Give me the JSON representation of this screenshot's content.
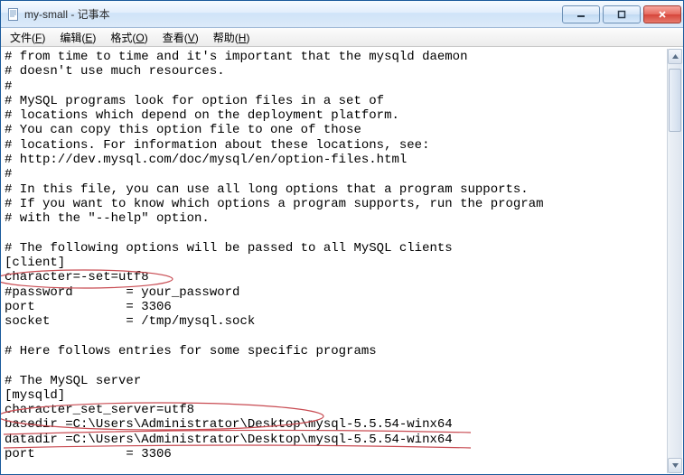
{
  "window": {
    "title": "my-small - 记事本"
  },
  "menu": {
    "file": {
      "label": "文件",
      "accel": "F"
    },
    "edit": {
      "label": "编辑",
      "accel": "E"
    },
    "format": {
      "label": "格式",
      "accel": "O"
    },
    "view": {
      "label": "查看",
      "accel": "V"
    },
    "help": {
      "label": "帮助",
      "accel": "H"
    }
  },
  "content": {
    "lines": [
      "# from time to time and it's important that the mysqld daemon",
      "# doesn't use much resources.",
      "#",
      "# MySQL programs look for option files in a set of",
      "# locations which depend on the deployment platform.",
      "# You can copy this option file to one of those",
      "# locations. For information about these locations, see:",
      "# http://dev.mysql.com/doc/mysql/en/option-files.html",
      "#",
      "# In this file, you can use all long options that a program supports.",
      "# If you want to know which options a program supports, run the program",
      "# with the \"--help\" option.",
      "",
      "# The following options will be passed to all MySQL clients",
      "[client]",
      "character=-set=utf8",
      "#password       = your_password",
      "port            = 3306",
      "socket          = /tmp/mysql.sock",
      "",
      "# Here follows entries for some specific programs",
      "",
      "# The MySQL server",
      "[mysqld]",
      "character_set_server=utf8",
      "basedir =C:\\Users\\Administrator\\Desktop\\mysql-5.5.54-winx64",
      "datadir =C:\\Users\\Administrator\\Desktop\\mysql-5.5.54-winx64",
      "port            = 3306"
    ]
  }
}
